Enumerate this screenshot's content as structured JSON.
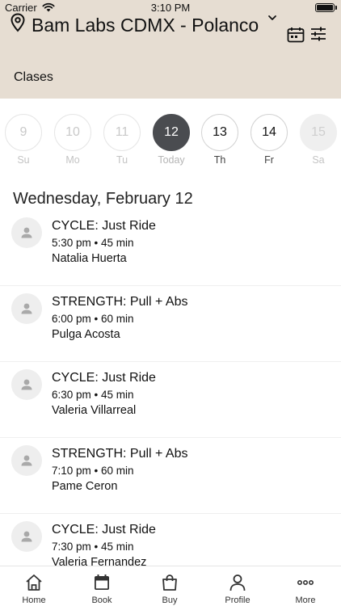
{
  "status_bar": {
    "carrier": "Carrier",
    "time": "3:10 PM"
  },
  "header": {
    "location": "Bam Labs CDMX - Polanco",
    "section": "Clases"
  },
  "dates": [
    {
      "num": "9",
      "dow": "Su",
      "state": "past"
    },
    {
      "num": "10",
      "dow": "Mo",
      "state": "past"
    },
    {
      "num": "11",
      "dow": "Tu",
      "state": "past"
    },
    {
      "num": "12",
      "dow": "Today",
      "state": "today"
    },
    {
      "num": "13",
      "dow": "Th",
      "state": "active"
    },
    {
      "num": "14",
      "dow": "Fr",
      "state": "active"
    },
    {
      "num": "15",
      "dow": "Sa",
      "state": "disabled"
    }
  ],
  "date_heading": "Wednesday, February 12",
  "classes": [
    {
      "title": "CYCLE: Just Ride",
      "when": "5:30 pm • 45 min",
      "coach": "Natalia Huerta"
    },
    {
      "title": "STRENGTH: Pull + Abs",
      "when": "6:00 pm • 60 min",
      "coach": "Pulga Acosta"
    },
    {
      "title": "CYCLE: Just Ride",
      "when": "6:30 pm • 45 min",
      "coach": "Valeria Villarreal"
    },
    {
      "title": "STRENGTH: Pull + Abs",
      "when": "7:10 pm • 60 min",
      "coach": "Pame Ceron"
    },
    {
      "title": "CYCLE: Just Ride",
      "when": "7:30 pm • 45 min",
      "coach": "Valeria Fernandez"
    }
  ],
  "tabs": [
    {
      "label": "Home",
      "icon": "home-icon"
    },
    {
      "label": "Book",
      "icon": "calendar-icon"
    },
    {
      "label": "Buy",
      "icon": "shopping-bag-icon"
    },
    {
      "label": "Profile",
      "icon": "person-icon"
    },
    {
      "label": "More",
      "icon": "more-dots-icon"
    }
  ],
  "colors": {
    "header_bg": "#e6ddd2",
    "today_bg": "#4a4c50",
    "divider": "#efefef"
  }
}
